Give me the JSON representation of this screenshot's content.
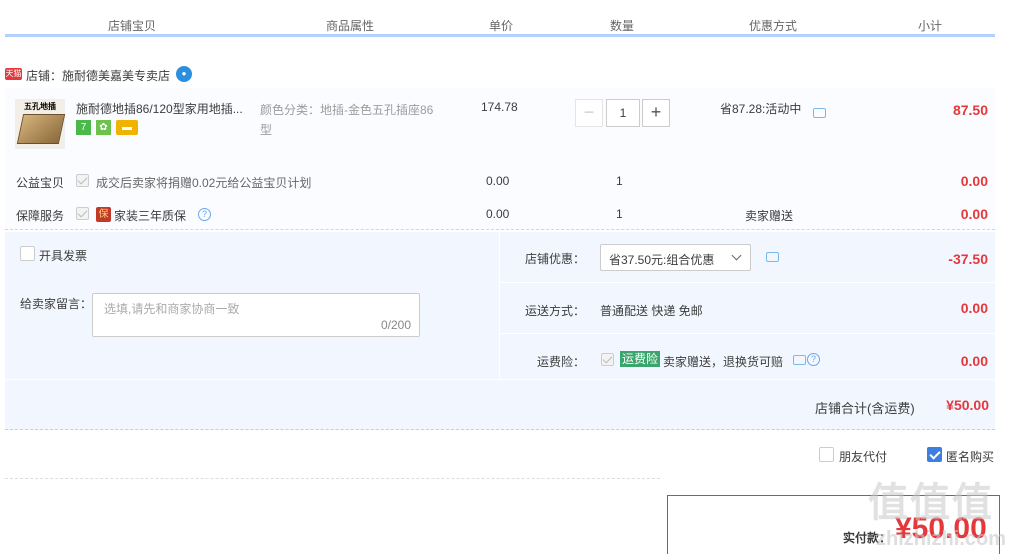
{
  "header": {
    "col_item": "店铺宝贝",
    "col_attr": "商品属性",
    "col_price": "单价",
    "col_qty": "数量",
    "col_promo": "优惠方式",
    "col_subtotal": "小计"
  },
  "shop": {
    "tmall_badge": "天猫",
    "name": "店铺：施耐德美嘉美专卖店"
  },
  "item": {
    "thumb_label": "五孔地插",
    "title": "施耐德地插86/120型家用地插...",
    "badge_7": "7",
    "sku": "颜色分类：地插-金色五孔插座86型",
    "price": "174.78",
    "qty": "1",
    "minus": "−",
    "plus": "+",
    "promo": "省87.28:活动中",
    "subtotal": "87.50"
  },
  "charity": {
    "label": "公益宝贝",
    "text": "成交后卖家将捐赠0.02元给公益宝贝计划",
    "price": "0.00",
    "qty": "1",
    "subtotal": "0.00"
  },
  "warranty": {
    "label": "保障服务",
    "bao_icon": "保",
    "text": "家装三年质保",
    "price": "0.00",
    "qty": "1",
    "promo": "卖家赠送",
    "subtotal": "0.00"
  },
  "invoice": {
    "label": "开具发票"
  },
  "message": {
    "label": "给卖家留言：",
    "placeholder": "选填,请先和商家协商一致",
    "count": "0/200"
  },
  "shop_discount": {
    "label": "店铺优惠：",
    "selected": "省37.50元:组合优惠",
    "amount": "-37.50"
  },
  "shipping": {
    "label": "运送方式：",
    "value": "普通配送 快递 免邮",
    "amount": "0.00"
  },
  "insurance": {
    "label": "运费险：",
    "tag": "运费险",
    "text": "卖家赠送，退换货可赔",
    "amount": "0.00"
  },
  "shop_total": {
    "label": "店铺合计(含运费)",
    "amount": "¥50.00"
  },
  "options": {
    "friend_pay": "朋友代付",
    "anonymous": "匿名购买"
  },
  "final": {
    "label": "实付款：",
    "amount": "¥50.00"
  },
  "watermark": {
    "top": "值值值",
    "bottom": "zhizhizhi.com"
  }
}
